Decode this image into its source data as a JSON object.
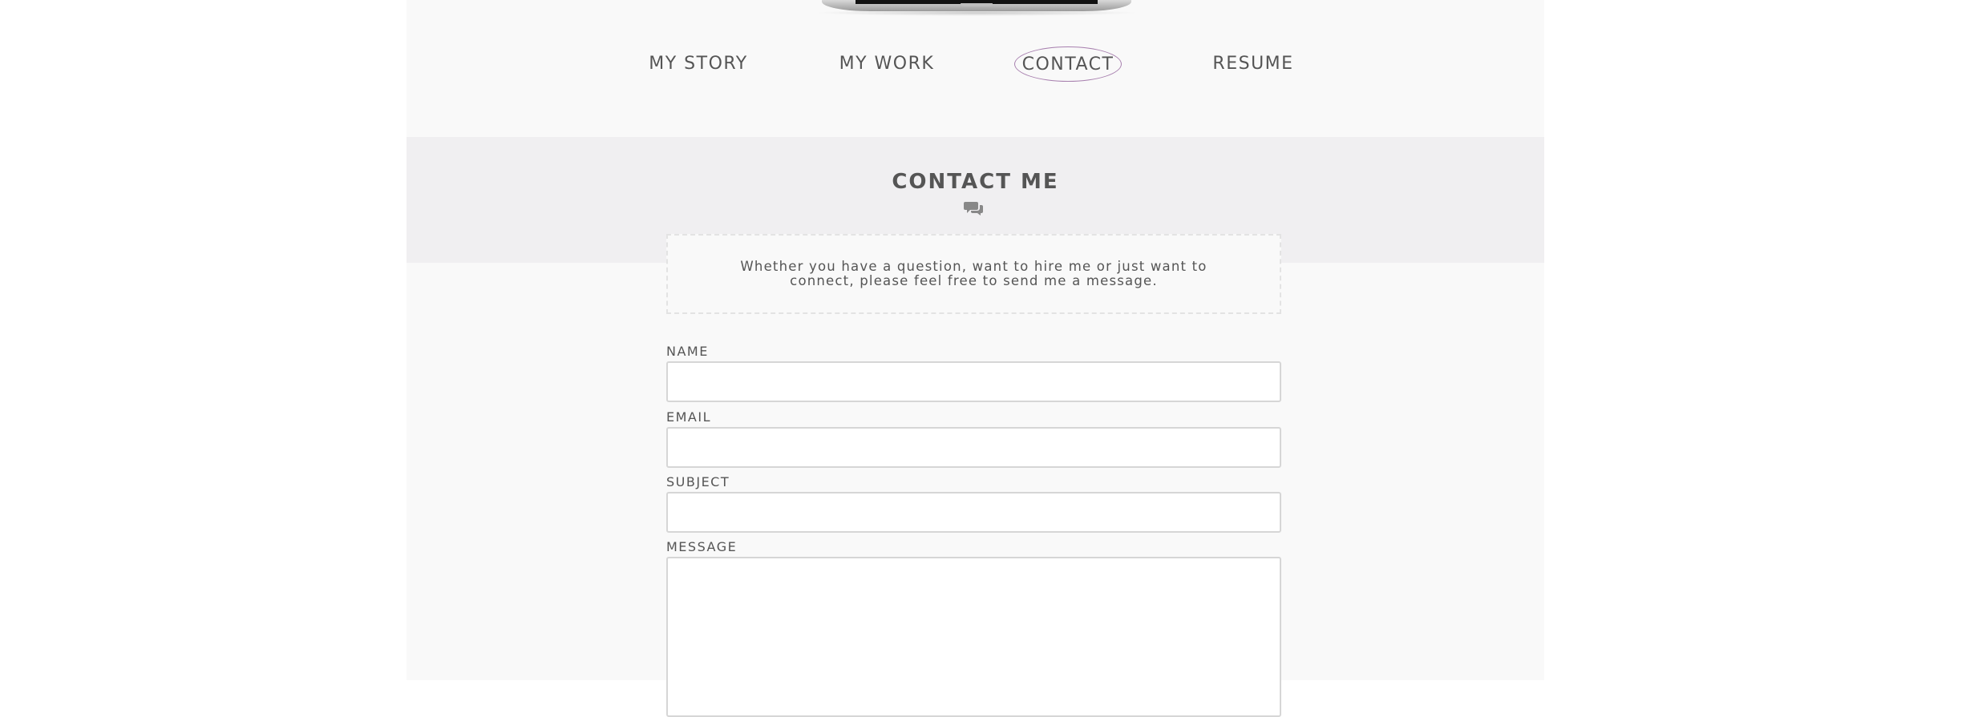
{
  "nav": {
    "items": [
      {
        "label": "MY STORY"
      },
      {
        "label": "MY WORK"
      },
      {
        "label": "CONTACT",
        "active": true
      },
      {
        "label": "RESUME"
      }
    ]
  },
  "contact": {
    "title": "CONTACT ME",
    "icon": "chat-bubbles-icon",
    "intro": "Whether you have a question, want to hire me or just want to connect, please feel free to send me a message."
  },
  "form": {
    "name_label": "NAME",
    "name_value": "",
    "email_label": "EMAIL",
    "email_value": "",
    "subject_label": "SUBJECT",
    "subject_value": "",
    "message_label": "MESSAGE",
    "message_value": ""
  },
  "colors": {
    "active_outline": "#a77fae",
    "band_background": "#f0eff1",
    "page_background": "#f9f9f9"
  }
}
